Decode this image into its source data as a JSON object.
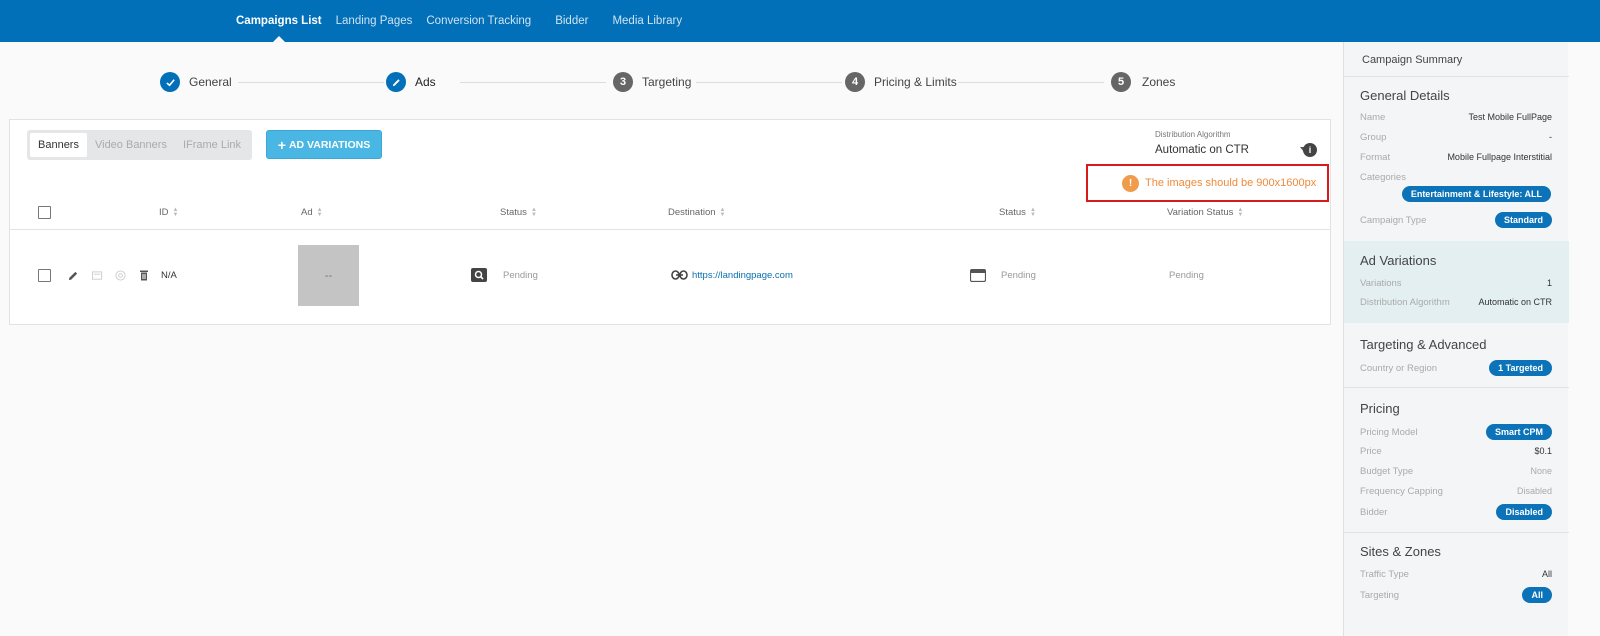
{
  "nav": {
    "items": [
      "Campaigns List",
      "Landing Pages",
      "Conversion Tracking",
      "Bidder",
      "Media Library"
    ],
    "active": "Campaigns List"
  },
  "stepper": {
    "steps": [
      {
        "num": "✓",
        "label": "General",
        "state": "done"
      },
      {
        "num": "✎",
        "label": "Ads",
        "state": "current"
      },
      {
        "num": "3",
        "label": "Targeting",
        "state": "todo"
      },
      {
        "num": "4",
        "label": "Pricing & Limits",
        "state": "todo"
      },
      {
        "num": "5",
        "label": "Zones",
        "state": "todo"
      }
    ]
  },
  "ads": {
    "tabs": [
      "Banners",
      "Video Banners",
      "IFrame Link"
    ],
    "active_tab": "Banners",
    "add_button": "AD VARIATIONS",
    "distribution": {
      "label": "Distribution Algorithm",
      "value": "Automatic on CTR"
    },
    "warning": "The images should be 900x1600px",
    "columns": [
      "ID",
      "Ad",
      "Status",
      "Destination",
      "Status",
      "Variation Status"
    ],
    "row": {
      "id": "N/A",
      "thumb": "--",
      "status": "Pending",
      "destination": "https://landingpage.com",
      "status2": "Pending",
      "variation_status": "Pending"
    }
  },
  "summary": {
    "title": "Campaign Summary",
    "general": {
      "heading": "General Details",
      "name_k": "Name",
      "name_v": "Test Mobile FullPage",
      "group_k": "Group",
      "group_v": "-",
      "format_k": "Format",
      "format_v": "Mobile Fullpage Interstitial",
      "categories_k": "Categories",
      "categories_v": "Entertainment & Lifestyle: ALL",
      "type_k": "Campaign Type",
      "type_v": "Standard"
    },
    "ad_variations": {
      "heading": "Ad Variations",
      "variations_k": "Variations",
      "variations_v": "1",
      "algo_k": "Distribution Algorithm",
      "algo_v": "Automatic on CTR"
    },
    "targeting": {
      "heading": "Targeting & Advanced",
      "country_k": "Country or Region",
      "country_v": "1 Targeted"
    },
    "pricing": {
      "heading": "Pricing",
      "model_k": "Pricing Model",
      "model_v": "Smart CPM",
      "price_k": "Price",
      "price_v": "$0.1",
      "budget_k": "Budget Type",
      "budget_v": "None",
      "freq_k": "Frequency Capping",
      "freq_v": "Disabled",
      "bidder_k": "Bidder",
      "bidder_v": "Disabled"
    },
    "sites": {
      "heading": "Sites & Zones",
      "traffic_k": "Traffic Type",
      "traffic_v": "All",
      "targeting_k": "Targeting",
      "targeting_v": "All"
    }
  }
}
